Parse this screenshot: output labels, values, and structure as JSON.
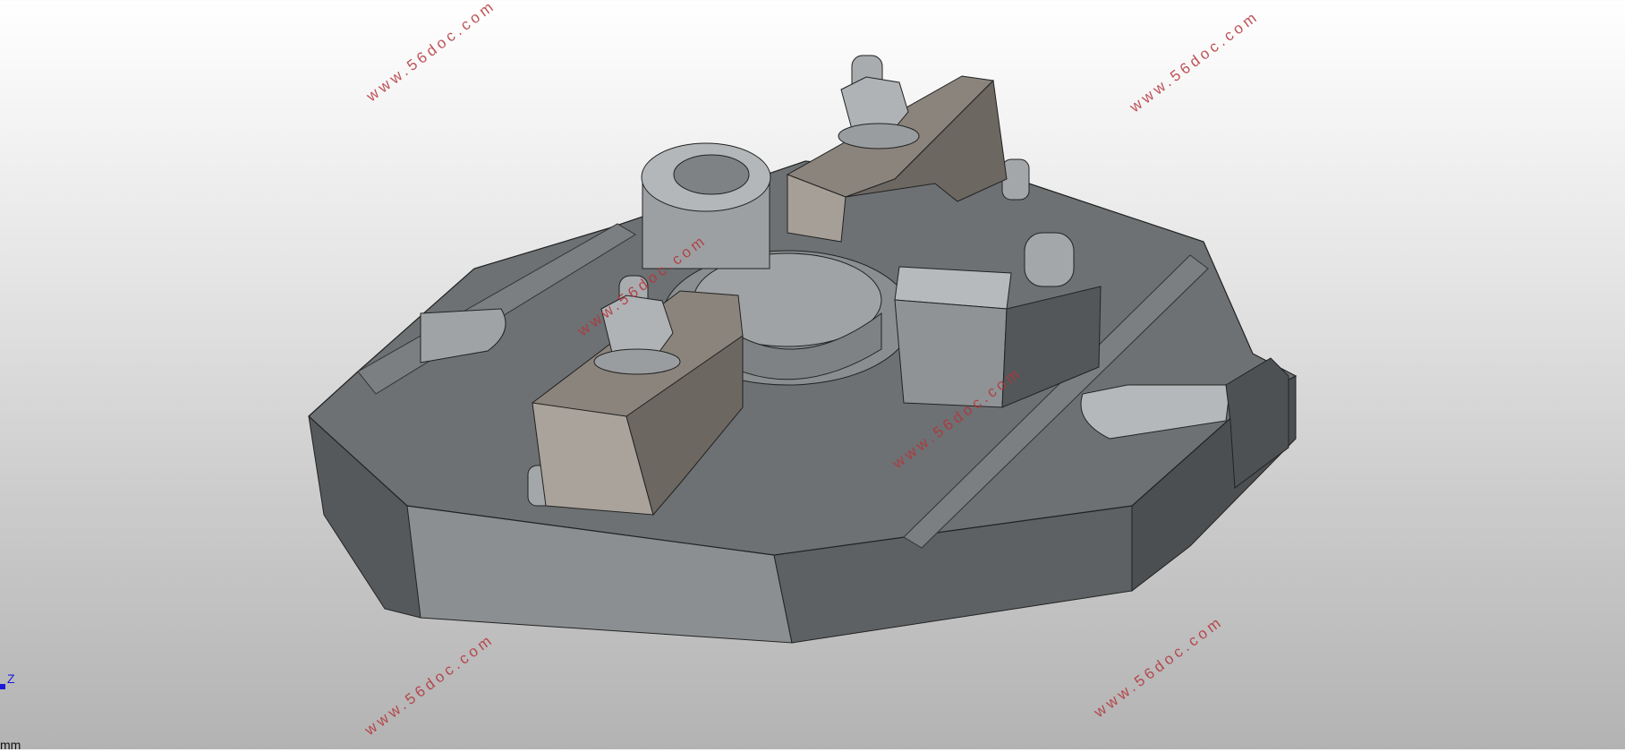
{
  "watermarks": [
    {
      "text": "www.56doc.com"
    },
    {
      "text": "www.56doc.com"
    },
    {
      "text": "www.56doc.com"
    },
    {
      "text": "www.56doc.com"
    },
    {
      "text": "www.56doc.com"
    },
    {
      "text": "www.56doc.com"
    },
    {
      "text": "www.56doc.com"
    }
  ],
  "triad": {
    "z_label": "Z"
  },
  "status": {
    "unit_label": "mm"
  },
  "colors": {
    "body_dark": "#5d6163",
    "body_top": "#727678",
    "body_light": "#8e9294",
    "clamp": "#8a847c",
    "clamp_dark": "#6c6761",
    "steel": "#a8abad",
    "watermark": "#b4343a",
    "triad": "#1a1ad8"
  }
}
